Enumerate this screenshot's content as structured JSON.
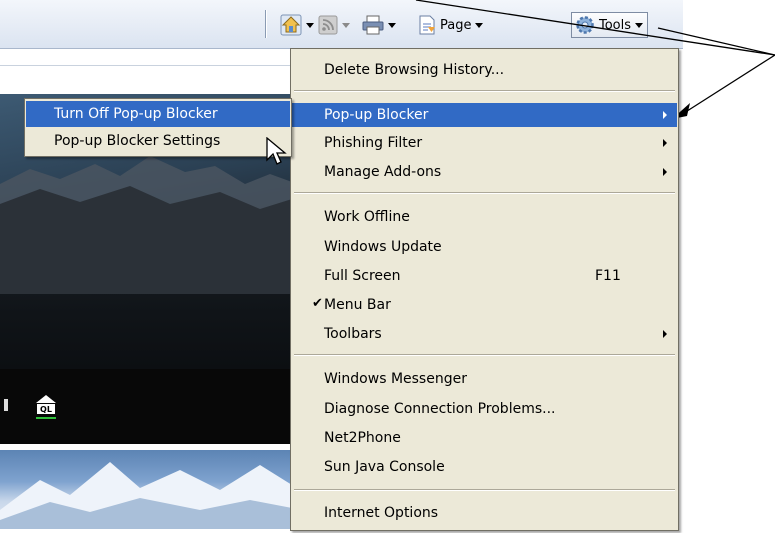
{
  "toolbar": {
    "page_label": "Page",
    "tools_label": "Tools"
  },
  "tools_menu": {
    "items": [
      {
        "label": "Delete Browsing History..."
      },
      {
        "label": "Pop-up Blocker"
      },
      {
        "label": "Phishing Filter"
      },
      {
        "label": "Manage Add-ons"
      },
      {
        "label": "Work Offline"
      },
      {
        "label": "Windows Update"
      },
      {
        "label": "Full Screen",
        "shortcut": "F11"
      },
      {
        "label": "Menu Bar",
        "checkmark": "✔"
      },
      {
        "label": "Toolbars"
      },
      {
        "label": "Windows Messenger"
      },
      {
        "label": "Diagnose Connection Problems..."
      },
      {
        "label": "Net2Phone"
      },
      {
        "label": "Sun Java Console"
      },
      {
        "label": "Internet Options"
      }
    ]
  },
  "popup_submenu": {
    "items": [
      {
        "label": "Turn Off Pop-up Blocker"
      },
      {
        "label": "Pop-up Blocker Settings"
      }
    ]
  },
  "colors": {
    "menu_bg": "#ece9d8",
    "highlight": "#316ac5",
    "commandbar": "#dbe4f1"
  },
  "icons": [
    "home-icon",
    "feeds-icon",
    "print-icon",
    "page-icon",
    "gear-icon",
    "mouse-cursor-icon",
    "ql-logo-icon"
  ]
}
